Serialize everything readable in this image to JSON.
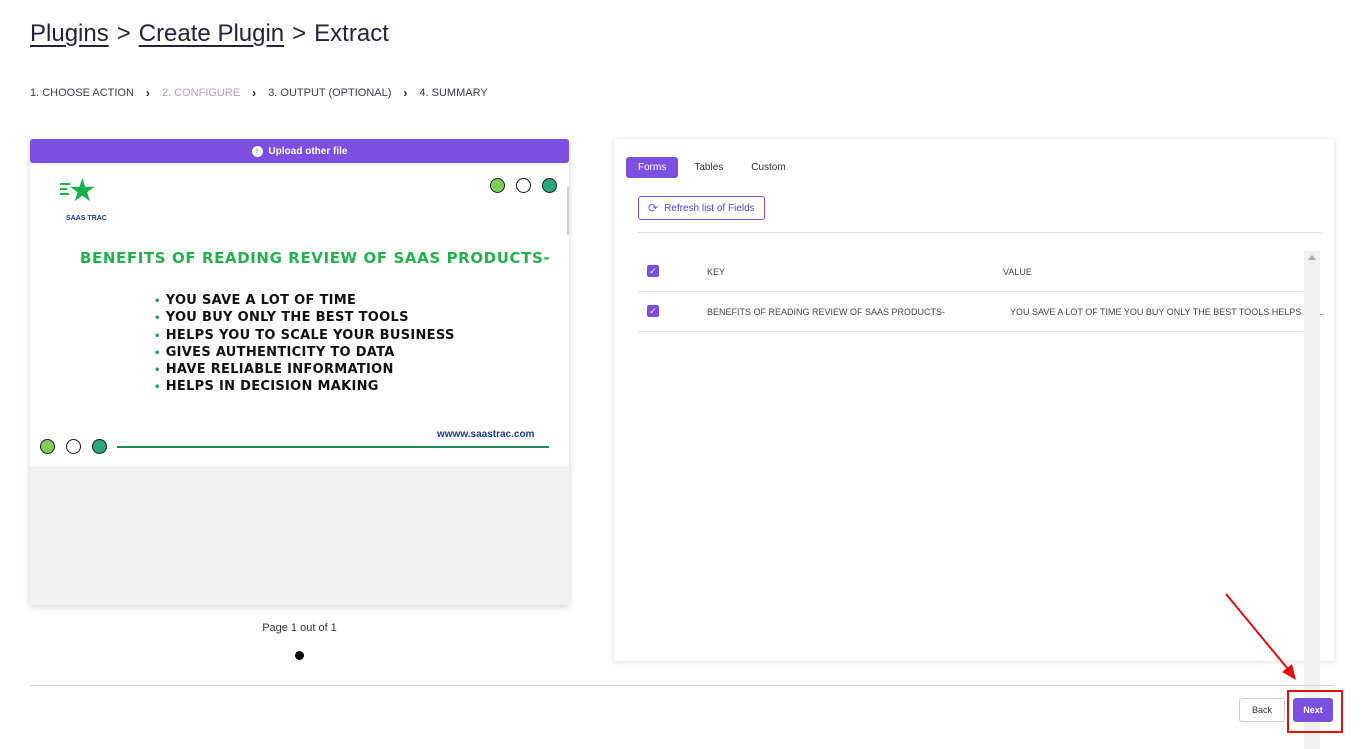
{
  "breadcrumb": {
    "plugins": "Plugins",
    "sep1": ">",
    "create": "Create Plugin",
    "sep2": ">",
    "current": "Extract"
  },
  "steps": [
    {
      "label": "1. CHOOSE ACTION",
      "active": false
    },
    {
      "label": "2. CONFIGURE",
      "active": true
    },
    {
      "label": "3. OUTPUT (OPTIONAL)",
      "active": false
    },
    {
      "label": "4. SUMMARY",
      "active": false
    }
  ],
  "chevron": "›",
  "upload": {
    "label": "Upload other file",
    "icon": "upload-arrow-icon"
  },
  "slide": {
    "logo_text": "SAAS TRAC",
    "title": "BENEFITS OF READING REVIEW OF SAAS PRODUCTS-",
    "bullets": [
      "YOU SAVE A LOT OF TIME",
      "YOU BUY ONLY THE BEST TOOLS",
      "HELPS YOU TO SCALE YOUR BUSINESS",
      "GIVES AUTHENTICITY TO DATA",
      "HAVE RELIABLE INFORMATION",
      "HELPS IN DECISION MAKING"
    ],
    "website": "wwww.saastrac.com",
    "colors": {
      "green": "#7cd05a",
      "teal": "#2aa87a",
      "title": "#22b14c"
    }
  },
  "pagination": {
    "text": "Page 1 out of 1"
  },
  "tabs": [
    {
      "label": "Forms",
      "active": true
    },
    {
      "label": "Tables",
      "active": false
    },
    {
      "label": "Custom",
      "active": false
    }
  ],
  "refresh": {
    "label": "Refresh list of Fields",
    "icon": "refresh-icon"
  },
  "table": {
    "headers": {
      "key": "KEY",
      "value": "VALUE"
    },
    "rows": [
      {
        "key": "BENEFITS OF READING REVIEW OF SAAS PRODUCTS-",
        "value": "YOU SAVE A LOT OF TIME YOU BUY ONLY THE BEST TOOLS HELPS YO...",
        "checked": true
      }
    ]
  },
  "actions": {
    "back": "Back",
    "next": "Next"
  },
  "accent_color": "#7b4fe0"
}
